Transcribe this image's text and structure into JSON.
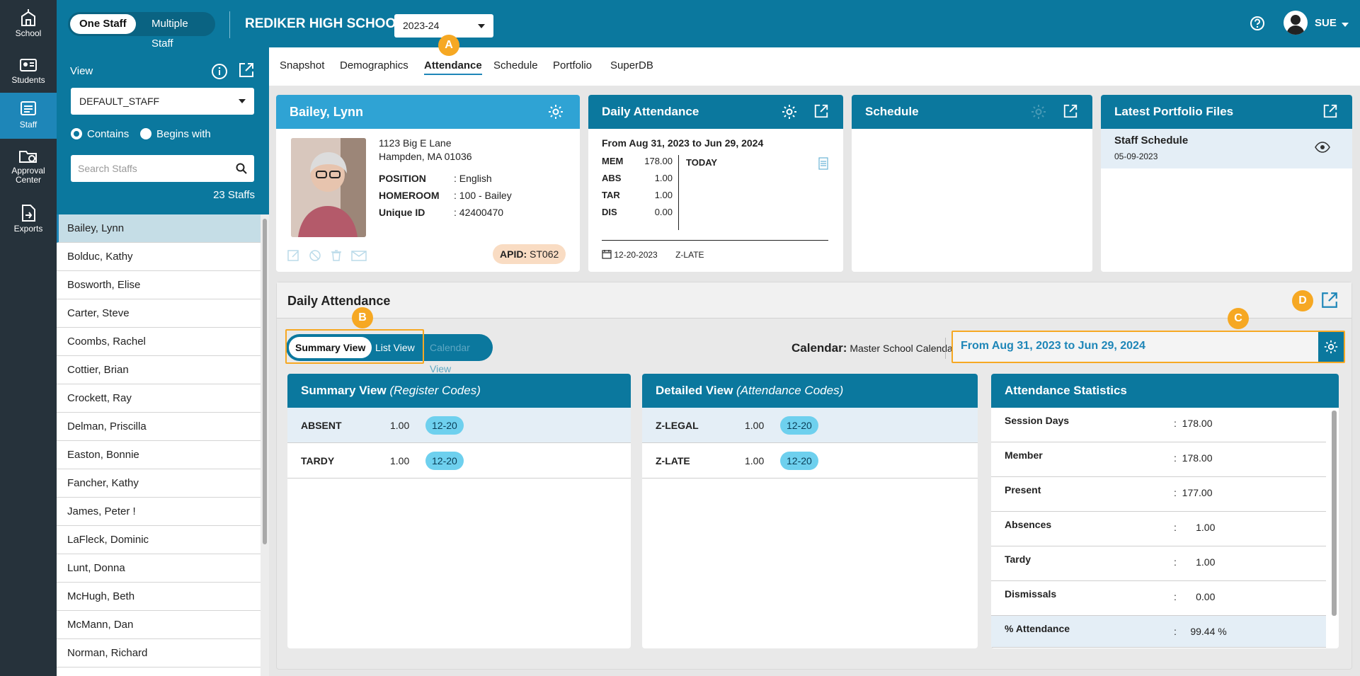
{
  "rail": [
    {
      "label": "School",
      "icon": "school-icon"
    },
    {
      "label": "Students",
      "icon": "students-icon"
    },
    {
      "label": "Staff",
      "icon": "staff-icon"
    },
    {
      "label_line1": "Approval",
      "label_line2": "Center",
      "icon": "approval-icon"
    },
    {
      "label": "Exports",
      "icon": "exports-icon"
    }
  ],
  "topbar": {
    "toggle_one": "One Staff",
    "toggle_multiple": "Multiple Staff",
    "school_name": "REDIKER HIGH SCHOOL",
    "year": "2023-24",
    "user": "SUE"
  },
  "markers": {
    "a": "A",
    "b": "B",
    "c": "C",
    "d": "D"
  },
  "leftpanel": {
    "view_label": "View",
    "view_value": "DEFAULT_STAFF",
    "radio_contains": "Contains",
    "radio_begins": "Begins with",
    "search_placeholder": "Search Staffs",
    "count": "23 Staffs",
    "staff": [
      "Bailey, Lynn",
      "Bolduc, Kathy",
      "Bosworth, Elise",
      "Carter, Steve",
      "Coombs, Rachel",
      "Cottier, Brian",
      "Crockett, Ray",
      "Delman, Priscilla",
      "Easton, Bonnie",
      "Fancher, Kathy",
      "James, Peter !",
      "LaFleck, Dominic",
      "Lunt, Donna",
      "McHugh, Beth",
      "McMann, Dan",
      "Norman, Richard"
    ]
  },
  "tabs": [
    "Snapshot",
    "Demographics",
    "Attendance",
    "Schedule",
    "Portfolio",
    "SuperDB"
  ],
  "profile": {
    "name": "Bailey, Lynn",
    "address1": "1123 Big E Lane",
    "address2": "Hampden, MA 01036",
    "fields": [
      {
        "label": "POSITION",
        "value": ": English"
      },
      {
        "label": "HOMEROOM",
        "value": ": 100 - Bailey"
      },
      {
        "label": "Unique ID",
        "value": ": 42400470"
      }
    ],
    "apid_label": "APID:",
    "apid_value": "ST062"
  },
  "daily_card": {
    "title": "Daily Attendance",
    "range": "From Aug 31, 2023 to Jun 29, 2024",
    "rows": [
      {
        "code": "MEM",
        "value": "178.00"
      },
      {
        "code": "ABS",
        "value": "1.00"
      },
      {
        "code": "TAR",
        "value": "1.00"
      },
      {
        "code": "DIS",
        "value": "0.00"
      }
    ],
    "today": "TODAY",
    "date": "12-20-2023",
    "code": "Z-LATE"
  },
  "schedule_card": {
    "title": "Schedule"
  },
  "portfolio_card": {
    "title": "Latest Portfolio Files",
    "file_name": "Staff Schedule",
    "file_date": "05-09-2023"
  },
  "attendance": {
    "title": "Daily Attendance",
    "view_summary": "Summary View",
    "view_list": "List View",
    "view_calendar": "Calendar View",
    "calendar_label": "Calendar:",
    "calendar_value": "Master School Calendar",
    "range": "From Aug 31, 2023 to Jun 29, 2024",
    "summary": {
      "title": "Summary View",
      "subtitle": "(Register Codes)",
      "rows": [
        {
          "code": "ABSENT",
          "value": "1.00",
          "date": "12-20"
        },
        {
          "code": "TARDY",
          "value": "1.00",
          "date": "12-20"
        }
      ]
    },
    "detailed": {
      "title": "Detailed View",
      "subtitle": "(Attendance Codes)",
      "rows": [
        {
          "code": "Z-LEGAL",
          "value": "1.00",
          "date": "12-20"
        },
        {
          "code": "Z-LATE",
          "value": "1.00",
          "date": "12-20"
        }
      ]
    },
    "stats": {
      "title": "Attendance Statistics",
      "rows": [
        {
          "label": "Session Days",
          "value": ":  178.00"
        },
        {
          "label": "Member",
          "value": ":  178.00"
        },
        {
          "label": "Present",
          "value": ":  177.00"
        },
        {
          "label": "Absences",
          "value": ":       1.00"
        },
        {
          "label": "Tardy",
          "value": ":       1.00"
        },
        {
          "label": "Dismissals",
          "value": ":       0.00"
        },
        {
          "label": "% Attendance",
          "value": ":     99.44 %"
        }
      ]
    }
  },
  "colors": {
    "brand": "#0b789e",
    "accent": "#1e86b8",
    "marker": "#f6a823",
    "pill": "#6ed0ee"
  }
}
